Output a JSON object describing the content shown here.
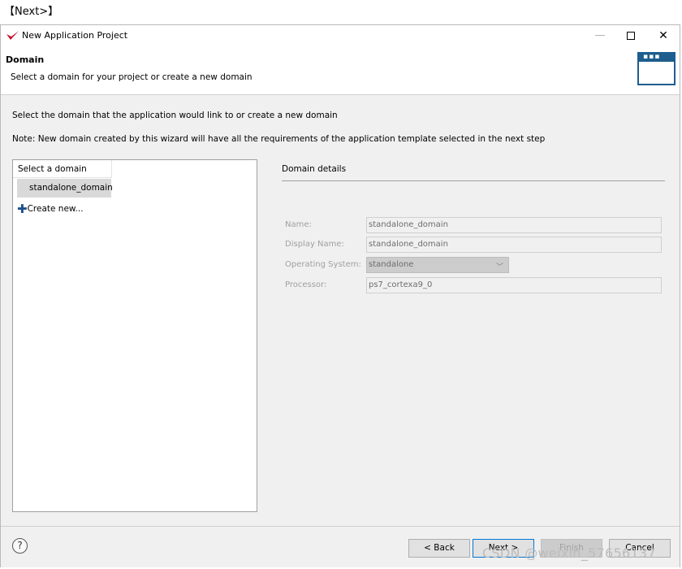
{
  "caption": "【Next>】",
  "window": {
    "title": "New Application Project",
    "controls": {
      "minimize": "—",
      "maximize": "",
      "close": "✕"
    }
  },
  "header": {
    "title": "Domain",
    "subtitle": "Select a domain for your project or create a new domain"
  },
  "main": {
    "instruction": "Select the domain that the application would link to or create a new domain",
    "note": "Note: New domain created by this wizard will have all the requirements of the application template selected in the next step",
    "domain_list": {
      "header": "Select a domain",
      "items": [
        "standalone_domain"
      ],
      "create_new": "Create new..."
    },
    "details": {
      "title": "Domain details",
      "fields": [
        {
          "label": "Name:",
          "value": "standalone_domain"
        },
        {
          "label": "Display Name:",
          "value": "standalone_domain"
        },
        {
          "label": "Operating System:",
          "value": "standalone"
        },
        {
          "label": "Processor:",
          "value": "ps7_cortexa9_0"
        }
      ]
    }
  },
  "footer": {
    "help": "?",
    "back": "< Back",
    "next": "Next >",
    "finish": "Finish",
    "cancel": "Cancel"
  },
  "watermark": "CSDN @weixin_57656137",
  "colors": {
    "accent": "#1d5e8e",
    "focus": "#0078d7",
    "logo": "#c8102e"
  },
  "icons": [
    "app-logo-icon",
    "minimize-icon",
    "maximize-icon",
    "close-icon",
    "wizard-window-icon",
    "plus-icon",
    "help-icon",
    "dropdown-arrow-icon"
  ]
}
